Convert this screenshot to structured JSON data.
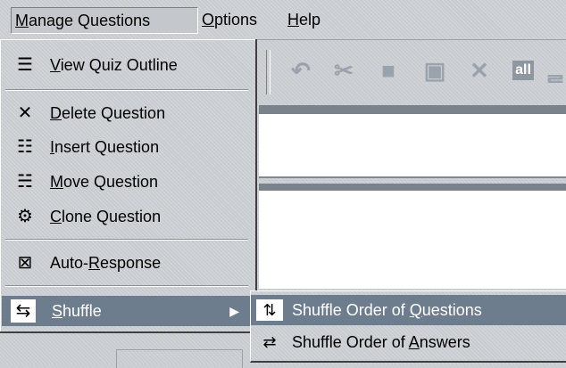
{
  "menubar": {
    "manage": {
      "mn": "M",
      "rest": "anage Questions"
    },
    "options": {
      "mn": "O",
      "rest": "ptions"
    },
    "help": {
      "mn": "H",
      "rest": "elp"
    }
  },
  "toolbar": {
    "undo_icon": "↶",
    "cut_icon": "✂",
    "copy_icon": "■",
    "paste_icon": "▣",
    "delete_icon": "✕",
    "all_label": "all",
    "all2_label": "ᆯ"
  },
  "menu": {
    "view": {
      "icon": "☰",
      "mn": "V",
      "rest": "iew Quiz Outline"
    },
    "delete": {
      "icon": "✕",
      "mn": "D",
      "rest": "elete Question"
    },
    "insert": {
      "icon": "☷",
      "mn": "I",
      "rest": "nsert Question"
    },
    "move": {
      "icon": "☵",
      "mn": "M",
      "rest": "ove Question"
    },
    "clone": {
      "icon": "⚙",
      "mn": "C",
      "rest": "lone Question"
    },
    "auto": {
      "icon": "⊠",
      "pre": "Auto-",
      "mn": "R",
      "rest": "esponse"
    },
    "shuffle": {
      "icon": "⇆",
      "mn": "S",
      "rest": "huffle",
      "arrow": "▶"
    }
  },
  "submenu": {
    "questions": {
      "icon": "⇅",
      "pre": "Shuffle Order of ",
      "mn": "Q",
      "rest": "uestions"
    },
    "answers": {
      "icon": "⇄",
      "pre": "Shuffle Order of ",
      "mn": "A",
      "rest": "nswers"
    }
  }
}
